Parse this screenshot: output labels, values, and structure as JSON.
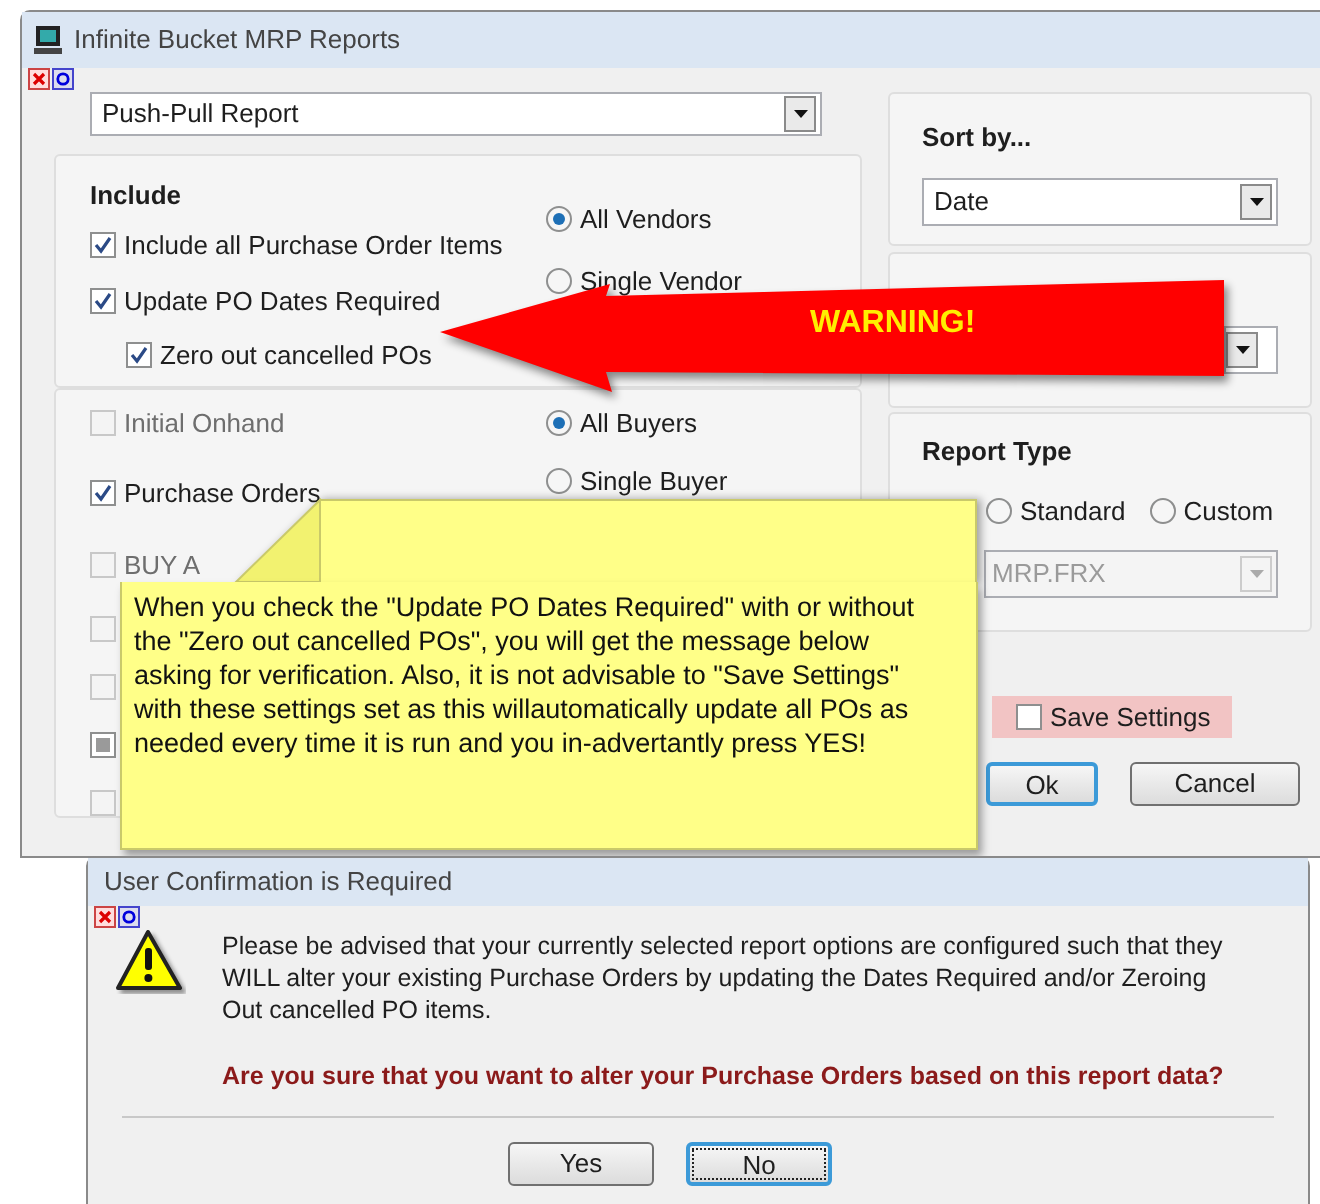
{
  "window": {
    "title": "Infinite Bucket MRP Reports"
  },
  "report_select": {
    "value": "Push-Pull Report"
  },
  "include": {
    "heading": "Include",
    "options": [
      {
        "label": "Include all Purchase Order Items",
        "checked": true
      },
      {
        "label": "Update PO Dates Required",
        "checked": true,
        "children": [
          {
            "label": "Zero out cancelled POs",
            "checked": true
          }
        ]
      }
    ]
  },
  "vendor_radios": [
    {
      "label": "All Vendors",
      "selected": true
    },
    {
      "label": "Single Vendor",
      "selected": false
    }
  ],
  "detail_checkboxes": [
    {
      "label": "Initial Onhand",
      "checked": false,
      "disabled": true,
      "indeterminate": false
    },
    {
      "label": "Purchase Orders",
      "checked": true,
      "disabled": false,
      "indeterminate": false
    },
    {
      "label": "BUY A",
      "checked": false,
      "disabled": true,
      "indeterminate": false
    },
    {
      "checked": false,
      "disabled": true,
      "indeterminate": false
    },
    {
      "checked": false,
      "disabled": true,
      "indeterminate": false
    },
    {
      "checked": false,
      "disabled": false,
      "indeterminate": true
    },
    {
      "checked": false,
      "disabled": true,
      "indeterminate": false
    }
  ],
  "buyer_radios": [
    {
      "label": "All Buyers",
      "selected": true
    },
    {
      "label": "Single Buyer",
      "selected": false
    }
  ],
  "sort_by": {
    "heading": "Sort by...",
    "value": "Date"
  },
  "report_type": {
    "heading": "Report Type",
    "options": [
      {
        "label": "Standard",
        "selected": false
      },
      {
        "label": "Custom",
        "selected": false
      }
    ],
    "template": {
      "value": "MRP.FRX",
      "disabled": true
    }
  },
  "save_settings": {
    "label": "Save Settings",
    "checked": false
  },
  "buttons": [
    {
      "label": "Ok",
      "focused": true
    },
    {
      "label": "Cancel",
      "focused": false
    }
  ],
  "annotation": {
    "warning": "WARNING!",
    "note": "When you check the \"Update PO Dates Required\" with or without the \"Zero out cancelled POs\", you will get the message below asking for verification. Also, it is not advisable to \"Save Settings\" with these settings set as this willautomatically update all POs as needed every time it is run and you in-advertantly press YES!"
  },
  "dialog": {
    "title": "User Confirmation is Required",
    "message": "Please be advised that your currently selected report options are configured such that they WILL alter your existing Purchase Orders by updating the Dates Required and/or Zeroing Out cancelled PO items.",
    "question": "Are you sure that you want to alter your Purchase Orders based on this report data?",
    "buttons": [
      {
        "label": "Yes",
        "focused": false
      },
      {
        "label": "No",
        "focused": true
      }
    ]
  }
}
